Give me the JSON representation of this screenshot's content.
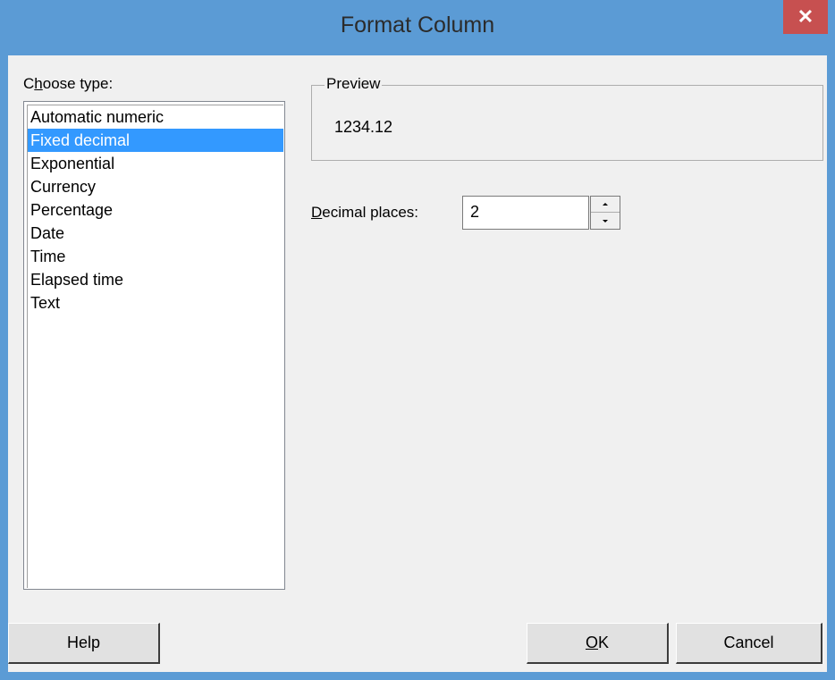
{
  "window": {
    "title": "Format Column",
    "close_glyph": "✕"
  },
  "type_list": {
    "label_first": "C",
    "label_access": "h",
    "label_rest": "oose type:",
    "items": [
      "Automatic numeric",
      "Fixed decimal",
      "Exponential",
      "Currency",
      "Percentage",
      "Date",
      "Time",
      "Elapsed time",
      "Text"
    ],
    "selected": "Fixed decimal"
  },
  "preview": {
    "title": "Preview",
    "value": "1234.12"
  },
  "decimal_places": {
    "label_access": "D",
    "label_rest": "ecimal places:",
    "value": "2"
  },
  "buttons": {
    "help": "Help",
    "ok_access": "O",
    "ok_rest": "K",
    "cancel": "Cancel"
  },
  "colors": {
    "title_bar": "#5b9bd5",
    "close": "#c75050",
    "selection": "#3399ff",
    "client": "#f0f0f0"
  },
  "icons": {
    "close": "close-icon",
    "spin_up": "arrow-up-icon",
    "spin_down": "arrow-down-icon"
  }
}
